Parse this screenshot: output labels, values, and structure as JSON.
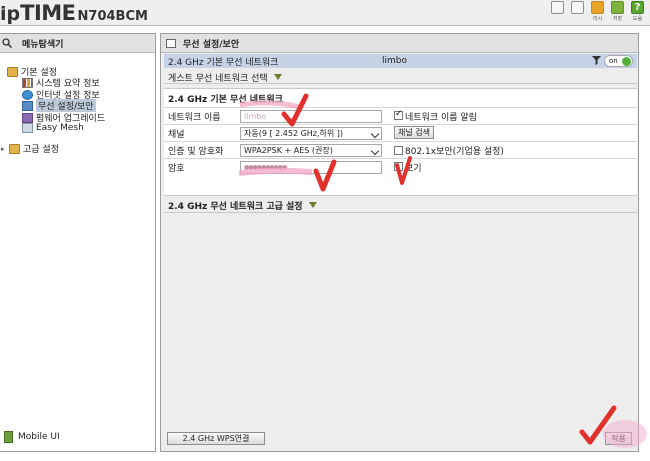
{
  "header": {
    "logo_ip": "ip",
    "logo_time": "TIME",
    "model": "N704BCM",
    "icons": [
      {
        "name": "home-icon",
        "label": ""
      },
      {
        "name": "doc-icon",
        "label": ""
      },
      {
        "name": "restart-icon",
        "label": "리시"
      },
      {
        "name": "save-icon",
        "label": "저장"
      },
      {
        "name": "help-icon",
        "label": "도움"
      }
    ]
  },
  "sidebar": {
    "title": "메뉴탐색기",
    "items": [
      {
        "label": "기본 설정",
        "icon": "folder-icon"
      },
      {
        "label": "시스템 요약 정보",
        "icon": "chart-icon"
      },
      {
        "label": "인터넷 설정 정보",
        "icon": "globe-icon"
      },
      {
        "label": "무선 설정/보안",
        "icon": "wireless-icon"
      },
      {
        "label": "펌웨어 업그레이드",
        "icon": "firmware-icon"
      },
      {
        "label": "Easy Mesh",
        "icon": "mesh-icon"
      },
      {
        "label": "고급 설정",
        "icon": "folder-icon"
      }
    ],
    "mobile_label": "Mobile UI"
  },
  "main": {
    "title": "무선 설정/보안",
    "network_bar": {
      "label": "2.4 GHz 기본 무선 네트워크",
      "ssid": "limbo",
      "toggle": "on"
    },
    "guest_label": "게스트 무선 네트워크 선택",
    "basic_section": {
      "title": "2.4 GHz 기본 무선 네트워크",
      "network_name_label": "네트워크 이름",
      "network_name_value": "limbo",
      "broadcast_label": "네트워크 이름 알림",
      "broadcast_checked": true,
      "channel_label": "채널",
      "channel_value": "자동(9 [ 2.452 GHz,하위 ])",
      "channel_search_label": "채널 검색",
      "auth_label": "인증 및 암호화",
      "auth_value": "WPA2PSK + AES (권장)",
      "enterprise_label": "802.1x보안(기업용 설정)",
      "enterprise_checked": false,
      "password_label": "암호",
      "password_value": "●●●●●●●●●●",
      "show_label": "보기",
      "show_checked": false
    },
    "advanced_label": "2.4 GHz 무선 네트워크 고급 설정",
    "wps_button": "2.4 GHz WPS연결",
    "apply_button": "적용"
  },
  "colors": {
    "annotation": "#e0312d",
    "highlight": "#f2a7c8",
    "netbar": "#c6d3e7"
  }
}
